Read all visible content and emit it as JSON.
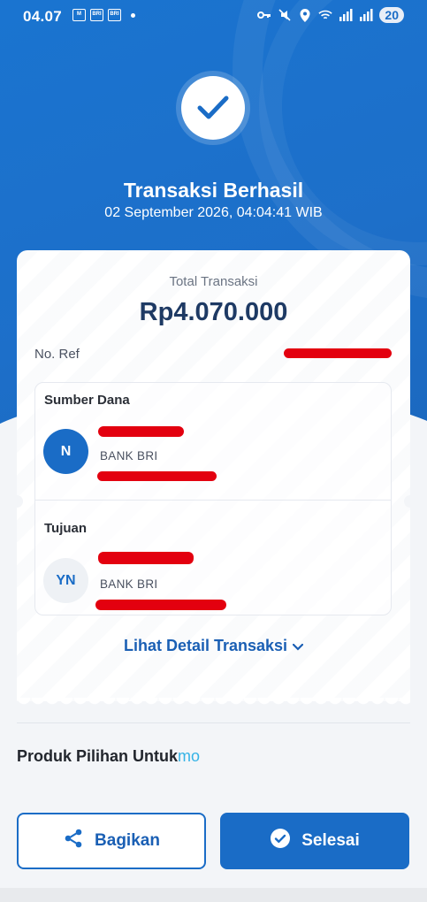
{
  "status_bar": {
    "time": "04.07",
    "mini_icons": [
      "M",
      "BRI",
      "BRI"
    ],
    "notification_count": "20"
  },
  "result": {
    "title": "Transaksi Berhasil",
    "datetime": "02 September 2026, 04:04:41 WIB"
  },
  "receipt": {
    "total_label": "Total Transaksi",
    "total_value": "Rp4.070.000",
    "ref_label": "No. Ref",
    "source": {
      "section_label": "Sumber Dana",
      "avatar_initials": "N",
      "bank": "BANK BRI"
    },
    "destination": {
      "section_label": "Tujuan",
      "avatar_initials": "YN",
      "bank": "BANK BRI"
    },
    "detail_link": "Lihat Detail Transaksi"
  },
  "products": {
    "heading": "Produk Pilihan Untuk",
    "heading_suffix": "mo"
  },
  "actions": {
    "share_label": "Bagikan",
    "done_label": "Selesai"
  },
  "colors": {
    "primary": "#1a6cc6",
    "redaction": "#e3000f",
    "accent_mo": "#35b3e6"
  }
}
